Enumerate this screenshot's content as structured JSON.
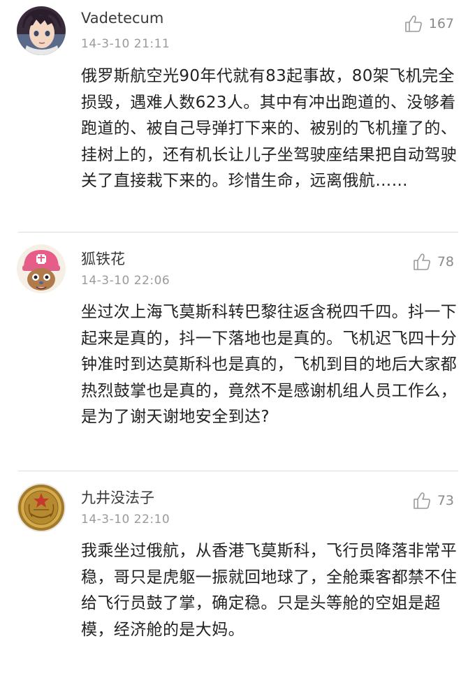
{
  "comments": [
    {
      "avatar_icon": "anime-character-avatar-icon",
      "username": "Vadetecum",
      "timestamp": "14-3-10 21:11",
      "likes": "167",
      "content": "俄罗斯航空光90年代就有83起事故，80架飞机完全损毁，遇难人数623人。其中有冲出跑道的、没够着跑道的、被自己导弹打下来的、被别的飞机撞了的、挂树上的，还有机长让儿子坐驾驶座结果把自动驾驶关了直接栽下来的。珍惜生命，远离俄航……"
    },
    {
      "avatar_icon": "chopper-cartoon-avatar-icon",
      "username": "狐铁花",
      "timestamp": "14-3-10 22:06",
      "likes": "78",
      "content": "坐过次上海飞莫斯科转巴黎往返含税四千四。抖一下起来是真的，抖一下落地也是真的。飞机迟飞四十分钟准时到达莫斯科也是真的，飞机到目的地后大家都热烈鼓掌也是真的，竟然不是感谢机组人员工作么，是为了谢天谢地安全到达?"
    },
    {
      "avatar_icon": "gold-medal-avatar-icon",
      "username": "九井没法子",
      "timestamp": "14-3-10 22:10",
      "likes": "73",
      "content": "我乘坐过俄航，从香港飞莫斯科，飞行员降落非常平稳，哥只是虎躯一振就回地球了，全舱乘客都禁不住给飞行员鼓了掌，确定稳。只是头等舱的空姐是超模，经济舱的是大妈。"
    }
  ],
  "colors": {
    "username": "#3a3a3a",
    "timestamp": "#9a9a9a",
    "content": "#222222",
    "like_icon": "#9a9a9a",
    "divider": "#dcdcdc"
  }
}
